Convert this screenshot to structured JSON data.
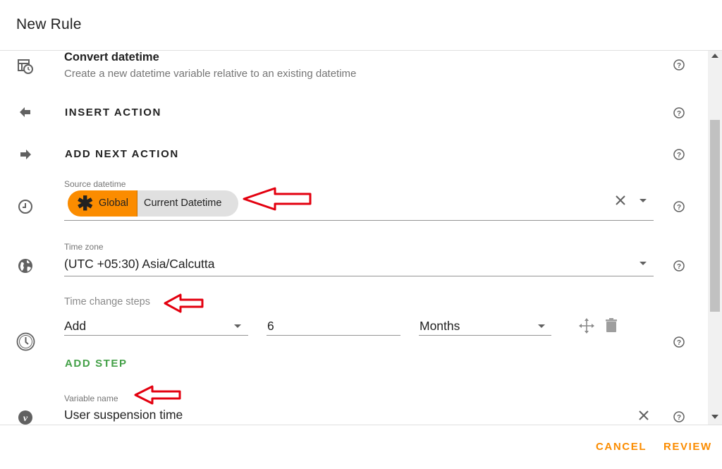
{
  "dialog": {
    "title": "New Rule"
  },
  "convert": {
    "title": "Convert datetime",
    "subtitle": "Create a new datetime variable relative to an existing datetime"
  },
  "actions": {
    "insert_label": "INSERT ACTION",
    "add_next_label": "ADD NEXT ACTION"
  },
  "source_datetime": {
    "label": "Source datetime",
    "chip_scope": "Global",
    "chip_value": "Current Datetime"
  },
  "time_zone": {
    "label": "Time zone",
    "value": "(UTC +05:30) Asia/Calcutta"
  },
  "time_change_steps": {
    "label": "Time change steps",
    "steps": [
      {
        "operation": "Add",
        "amount": "6",
        "unit": "Months"
      }
    ],
    "add_step_label": "ADD STEP"
  },
  "variable_name": {
    "label": "Variable name",
    "value": "User suspension time"
  },
  "footer": {
    "cancel_label": "CANCEL",
    "review_label": "REVIEW"
  },
  "colors": {
    "accent": "#fb8c00",
    "add_step": "#43a047",
    "annotation_arrow": "#e3000f"
  },
  "icons": {
    "convert": "datetime-convert-icon",
    "insert": "arrow-left-icon",
    "add_next": "arrow-right-icon",
    "source": "clock-icon",
    "timezone": "globe-icon",
    "steps": "stopwatch-clock-icon",
    "variable": "variable-v-icon",
    "help": "help-circle-icon",
    "clear": "close-icon",
    "dropdown": "chevron-down-icon",
    "move": "move-arrows-icon",
    "delete": "trash-icon",
    "global": "asterisk-icon"
  }
}
